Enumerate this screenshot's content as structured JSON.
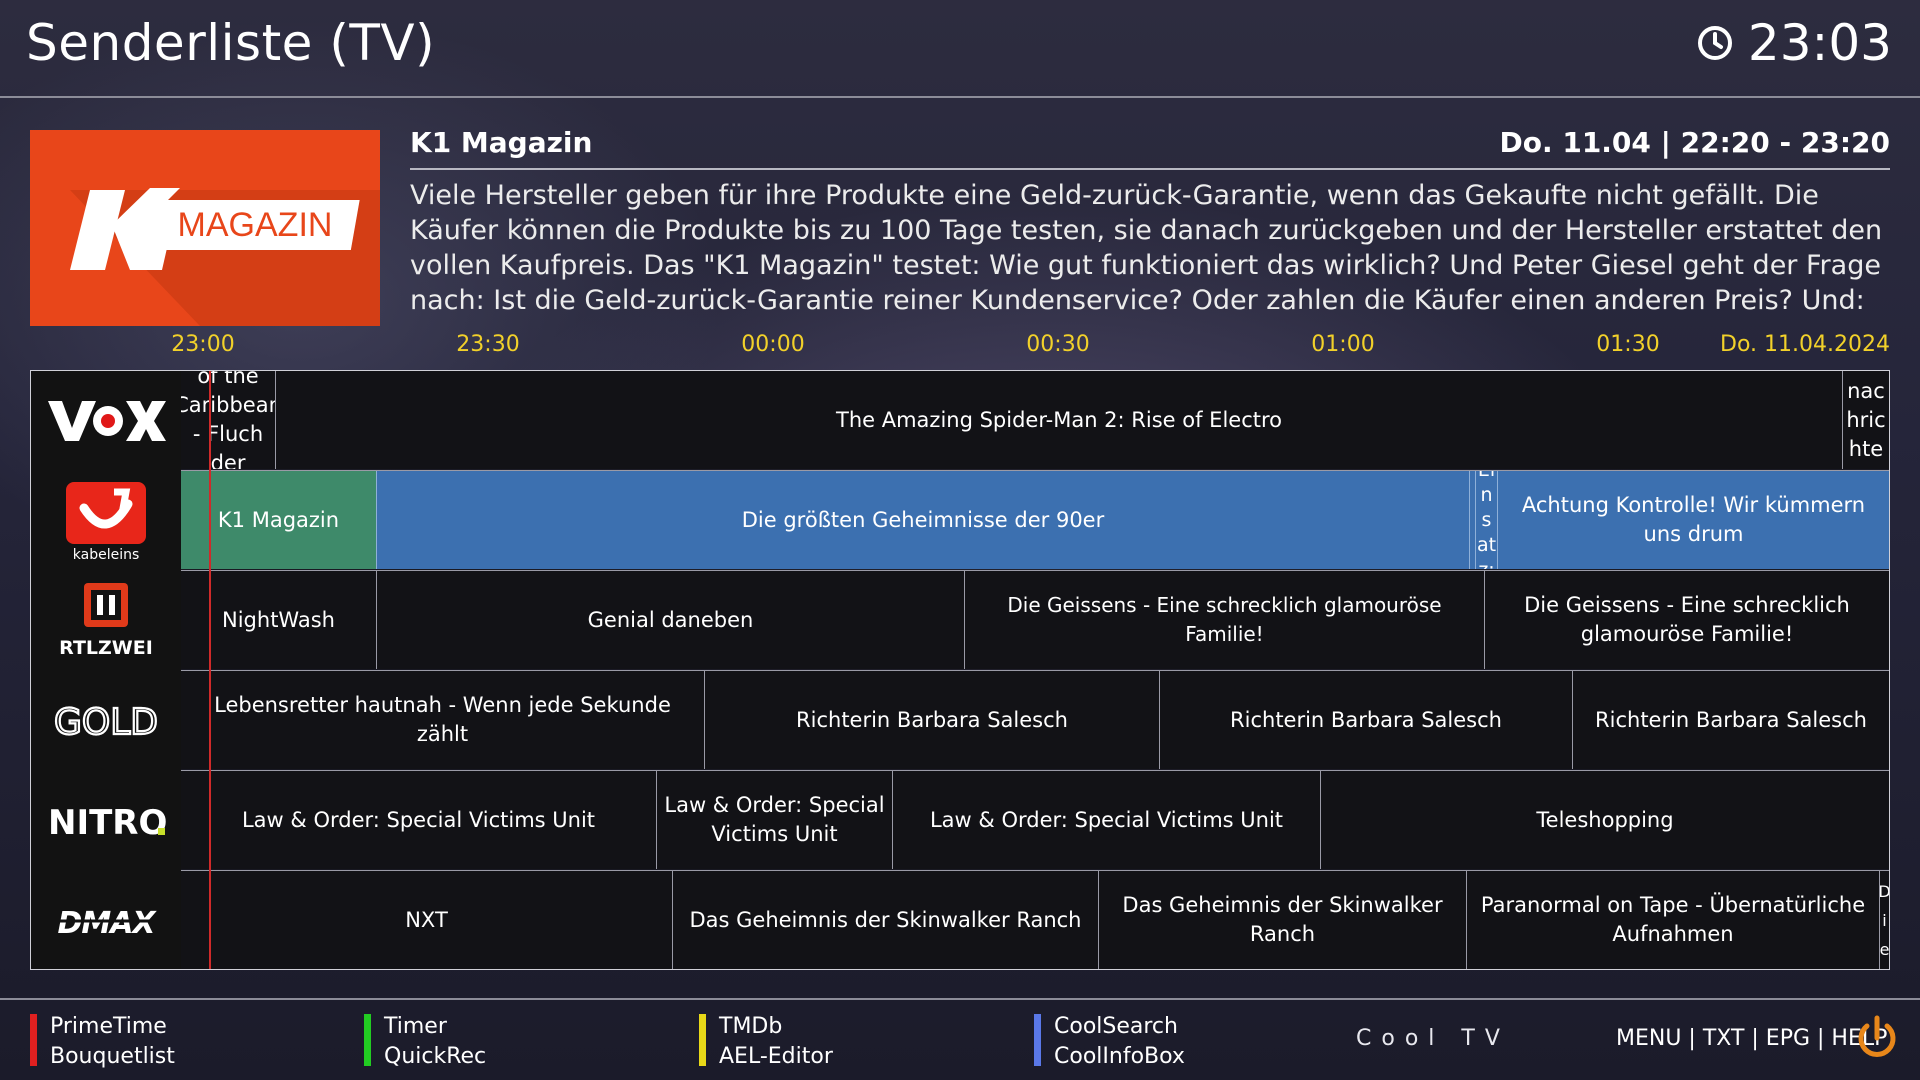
{
  "header": {
    "title": "Senderliste (TV)",
    "clock": "23:03"
  },
  "event": {
    "title": "K1 Magazin",
    "time": "Do. 11.04 | 22:20  - 23:20",
    "description": "Viele Hersteller geben für ihre Produkte eine Geld-zurück-Garantie, wenn das Gekaufte nicht gefällt. Die Käufer können die Produkte bis zu 100 Tage testen, sie danach zurückgeben und der Hersteller erstattet den vollen Kaufpreis. Das \"K1 Magazin\" testet: Wie gut funktioniert das wirklich? Und Peter Giesel geht der Frage nach: Ist die Geld-zurück-Garantie reiner Kundenservice? Oder zahlen die Käufer einen anderen Preis? Und: Die",
    "logo_text": "MAGAZIN"
  },
  "timeline": {
    "ticks": [
      "23:00",
      "23:30",
      "00:00",
      "00:30",
      "01:00",
      "01:30"
    ],
    "date": "Do. 11.04.2024"
  },
  "channels": [
    {
      "name": "VOX",
      "logo": "vox-logo",
      "programs": [
        "of the Caribbean - Fluch der",
        "The Amazing Spider-Man 2: Rise of Electro",
        "nachrichte"
      ]
    },
    {
      "name": "kabel eins",
      "logo": "kabeleins-logo",
      "selected": true,
      "programs": [
        "K1 Magazin",
        "Die größten Geheimnisse der 90er",
        "",
        "Einsatz:",
        "Achtung Kontrolle! Wir kümmern uns drum"
      ]
    },
    {
      "name": "RTLZWEI",
      "logo": "rtlzwei-logo",
      "programs": [
        "NightWash",
        "Genial daneben",
        "Die Geissens - Eine schrecklich glamouröse Familie!",
        "Die Geissens - Eine schrecklich glamouröse Familie!"
      ]
    },
    {
      "name": "GOLD",
      "logo": "gold-logo",
      "programs": [
        "Lebensretter hautnah - Wenn jede Sekunde zählt",
        "Richterin Barbara Salesch",
        "Richterin Barbara Salesch",
        "Richterin Barbara Salesch"
      ]
    },
    {
      "name": "NITRO.",
      "logo": "nitro-logo",
      "programs": [
        "Law & Order: Special Victims Unit",
        "Law & Order: Special Victims Unit",
        "Law & Order: Special Victims Unit",
        "Teleshopping"
      ]
    },
    {
      "name": "DMAX",
      "logo": "dmax-logo",
      "programs": [
        "NXT",
        "Das Geheimnis der Skinwalker Ranch",
        "Das Geheimnis der Skinwalker Ranch",
        "Paranormal on Tape - Übernatürliche Aufnahmen",
        "Die"
      ]
    }
  ],
  "footer": {
    "red": {
      "line1": "PrimeTime",
      "line2": "Bouquetlist",
      "color": "#e02020"
    },
    "green": {
      "line1": "Timer",
      "line2": "QuickRec",
      "color": "#22cc22"
    },
    "yellow": {
      "line1": "TMDb",
      "line2": "AEL-Editor",
      "color": "#e8d818"
    },
    "blue": {
      "line1": "CoolSearch",
      "line2": "CoolInfoBox",
      "color": "#5a78e8"
    },
    "center": "Cool TV",
    "keys": "MENU | TXT | EPG | HELP"
  },
  "colors": {
    "accent_yellow": "#f2d12a",
    "selected_blue": "#3c70b0",
    "current_green": "#3e8a6a",
    "now_line": "#d02a2a",
    "k1_orange": "#e8461a"
  }
}
